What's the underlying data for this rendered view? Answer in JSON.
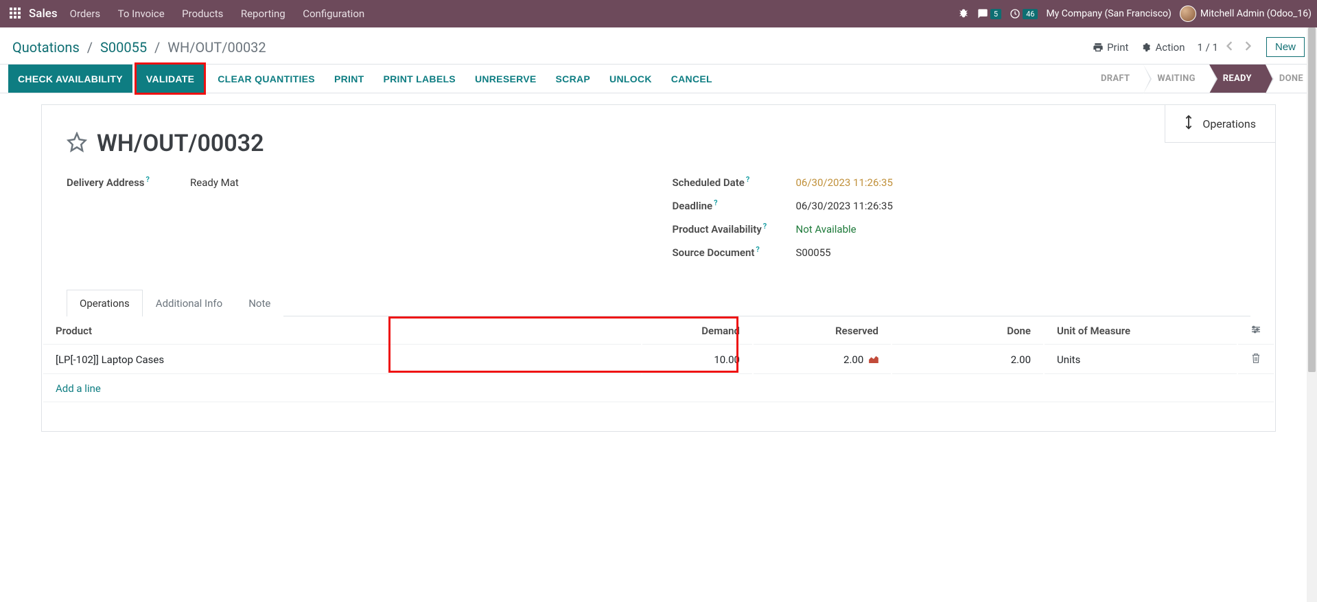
{
  "topbar": {
    "brand": "Sales",
    "menu": [
      "Orders",
      "To Invoice",
      "Products",
      "Reporting",
      "Configuration"
    ],
    "messages_badge": "5",
    "activities_badge": "46",
    "company": "My Company (San Francisco)",
    "username": "Mitchell Admin (Odoo_16)"
  },
  "breadcrumb": {
    "items": [
      "Quotations",
      "S00055",
      "WH/OUT/00032"
    ]
  },
  "subbar": {
    "print": "Print",
    "action": "Action",
    "pager": "1 / 1",
    "new_btn": "New"
  },
  "actions": {
    "check_availability": "CHECK AVAILABILITY",
    "validate": "VALIDATE",
    "clear_quantities": "CLEAR QUANTITIES",
    "print": "PRINT",
    "print_labels": "PRINT LABELS",
    "unreserve": "UNRESERVE",
    "scrap": "SCRAP",
    "unlock": "UNLOCK",
    "cancel": "CANCEL"
  },
  "statusbar": {
    "draft": "DRAFT",
    "waiting": "WAITING",
    "ready": "READY",
    "done": "DONE"
  },
  "sheet": {
    "operations_tab": "Operations",
    "title": "WH/OUT/00032",
    "left": {
      "delivery_address_label": "Delivery Address",
      "delivery_address": "Ready Mat"
    },
    "right": {
      "scheduled_date_label": "Scheduled Date",
      "scheduled_date": "06/30/2023 11:26:35",
      "deadline_label": "Deadline",
      "deadline": "06/30/2023 11:26:35",
      "availability_label": "Product Availability",
      "availability": "Not Available",
      "source_label": "Source Document",
      "source": "S00055"
    }
  },
  "tabs": {
    "operations": "Operations",
    "additional": "Additional Info",
    "note": "Note"
  },
  "grid": {
    "headers": {
      "product": "Product",
      "demand": "Demand",
      "reserved": "Reserved",
      "done": "Done",
      "uom": "Unit of Measure"
    },
    "rows": [
      {
        "product": "[LP[-102]] Laptop Cases",
        "demand": "10.00",
        "reserved": "2.00",
        "done": "2.00",
        "uom": "Units"
      }
    ],
    "add_line": "Add a line"
  }
}
